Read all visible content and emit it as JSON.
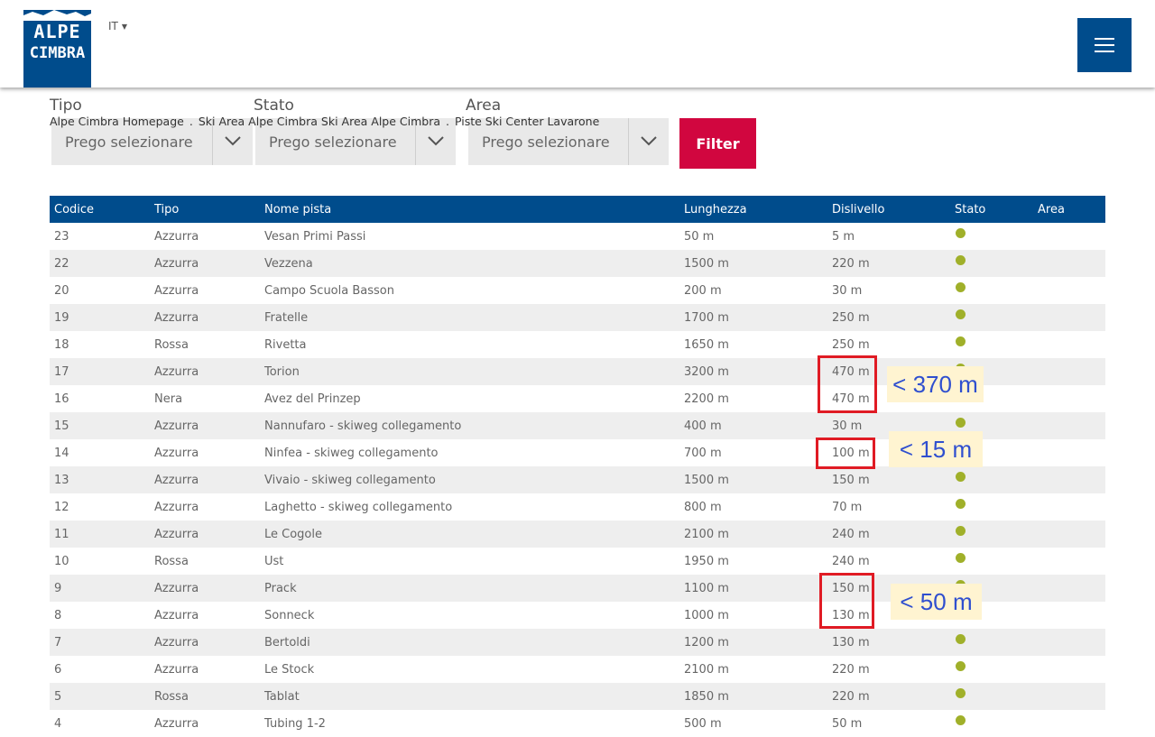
{
  "header": {
    "logo_lines": [
      "ALPE",
      "CIMBRA"
    ],
    "language": "IT"
  },
  "filters": {
    "tipo_label": "Tipo",
    "stato_label": "Stato",
    "area_label": "Area",
    "breadcrumb": [
      "Alpe Cimbra Homepage",
      "Ski Area Alpe Cimbra",
      "Ski Area Alpe Cimbra",
      "Piste Ski Center Lavarone"
    ],
    "tipo_value": "Prego selezionare",
    "stato_value": "Prego selezionare",
    "area_value": "Prego selezionare",
    "filter_button": "Filter"
  },
  "table": {
    "columns": [
      "Codice",
      "Tipo",
      "Nome pista",
      "Lunghezza",
      "Dislivello",
      "Stato",
      "Area"
    ],
    "status_color": "#a0b02a",
    "rows": [
      {
        "codice": "23",
        "tipo": "Azzurra",
        "nome": "Vesan Primi Passi",
        "lunghezza": "50 m",
        "dislivello": "5 m"
      },
      {
        "codice": "22",
        "tipo": "Azzurra",
        "nome": "Vezzena",
        "lunghezza": "1500 m",
        "dislivello": "220 m"
      },
      {
        "codice": "20",
        "tipo": "Azzurra",
        "nome": "Campo Scuola Basson",
        "lunghezza": "200 m",
        "dislivello": "30 m"
      },
      {
        "codice": "19",
        "tipo": "Azzurra",
        "nome": "Fratelle",
        "lunghezza": "1700 m",
        "dislivello": "250 m"
      },
      {
        "codice": "18",
        "tipo": "Rossa",
        "nome": "Rivetta",
        "lunghezza": "1650 m",
        "dislivello": "250 m"
      },
      {
        "codice": "17",
        "tipo": "Azzurra",
        "nome": "Torion",
        "lunghezza": "3200 m",
        "dislivello": "470 m"
      },
      {
        "codice": "16",
        "tipo": "Nera",
        "nome": "Avez del Prinzep",
        "lunghezza": "2200 m",
        "dislivello": "470 m"
      },
      {
        "codice": "15",
        "tipo": "Azzurra",
        "nome": "Nannufaro - skiweg collegamento",
        "lunghezza": "400 m",
        "dislivello": "30 m"
      },
      {
        "codice": "14",
        "tipo": "Azzurra",
        "nome": "Ninfea - skiweg collegamento",
        "lunghezza": "700 m",
        "dislivello": "100 m"
      },
      {
        "codice": "13",
        "tipo": "Azzurra",
        "nome": "Vivaio - skiweg collegamento",
        "lunghezza": "1500 m",
        "dislivello": "150 m"
      },
      {
        "codice": "12",
        "tipo": "Azzurra",
        "nome": "Laghetto - skiweg collegamento",
        "lunghezza": "800 m",
        "dislivello": "70 m"
      },
      {
        "codice": "11",
        "tipo": "Azzurra",
        "nome": "Le Cogole",
        "lunghezza": "2100 m",
        "dislivello": "240 m"
      },
      {
        "codice": "10",
        "tipo": "Rossa",
        "nome": "Ust",
        "lunghezza": "1950 m",
        "dislivello": "240 m"
      },
      {
        "codice": "9",
        "tipo": "Azzurra",
        "nome": "Prack",
        "lunghezza": "1100 m",
        "dislivello": "150 m"
      },
      {
        "codice": "8",
        "tipo": "Azzurra",
        "nome": "Sonneck",
        "lunghezza": "1000 m",
        "dislivello": "130 m"
      },
      {
        "codice": "7",
        "tipo": "Azzurra",
        "nome": "Bertoldi",
        "lunghezza": "1200 m",
        "dislivello": "130 m"
      },
      {
        "codice": "6",
        "tipo": "Azzurra",
        "nome": "Le Stock",
        "lunghezza": "2100 m",
        "dislivello": "220 m"
      },
      {
        "codice": "5",
        "tipo": "Rossa",
        "nome": "Tablat",
        "lunghezza": "1850 m",
        "dislivello": "220 m"
      },
      {
        "codice": "4",
        "tipo": "Azzurra",
        "nome": "Tubing 1-2",
        "lunghezza": "500 m",
        "dislivello": "50 m"
      }
    ]
  },
  "annotations": {
    "note_1": "< 370 m",
    "note_2": "< 15 m",
    "note_3": "< 50 m",
    "box_color": "#e01b24",
    "note_bg": "#fff4d1"
  }
}
